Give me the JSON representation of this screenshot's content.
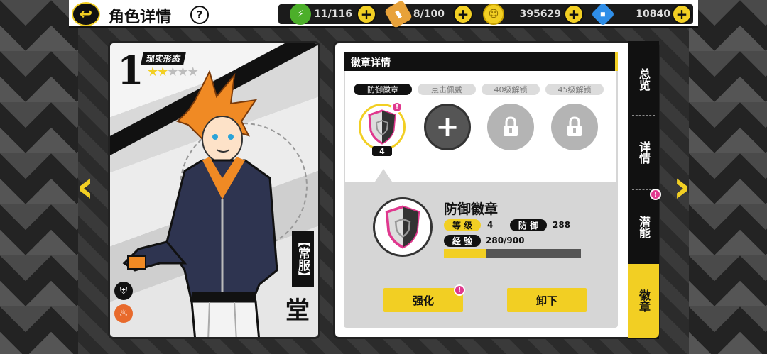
{
  "header": {
    "title": "角色详情",
    "help_label": "?",
    "back_label": "↩",
    "resources": [
      {
        "name": "stamina",
        "value": "11/116"
      },
      {
        "name": "battery",
        "value": "8/100"
      },
      {
        "name": "coins",
        "value": "395629"
      },
      {
        "name": "gems",
        "value": "10840"
      }
    ],
    "plus_label": "+"
  },
  "character": {
    "rank": "1",
    "form": "现实形态",
    "stars_total": 5,
    "stars_filled": 2,
    "outfit": "【常服】",
    "name": "堂"
  },
  "badge_panel": {
    "title": "徽章详情",
    "slots": [
      {
        "label": "防御徽章",
        "state": "equipped",
        "level": "4"
      },
      {
        "label": "点击佩戴",
        "state": "add"
      },
      {
        "label": "40级解锁",
        "state": "locked"
      },
      {
        "label": "45级解锁",
        "state": "locked"
      }
    ],
    "alert_mark": "!",
    "selected": {
      "name": "防御徽章",
      "level_label": "等 级",
      "level_value": "4",
      "defense_label": "防 御",
      "defense_value": "288",
      "exp_label": "经 验",
      "exp_value": "280/900",
      "exp_fraction": 0.31
    },
    "buttons": {
      "upgrade": "强化",
      "unequip": "卸下"
    }
  },
  "side_tabs": [
    {
      "label": "总览",
      "active": false
    },
    {
      "label": "详情",
      "active": false
    },
    {
      "label": "潜能",
      "active": false
    },
    {
      "label": "徽章",
      "active": true
    }
  ],
  "colors": {
    "accent": "#f2cf23",
    "dark": "#111111",
    "alert": "#e0388e"
  }
}
